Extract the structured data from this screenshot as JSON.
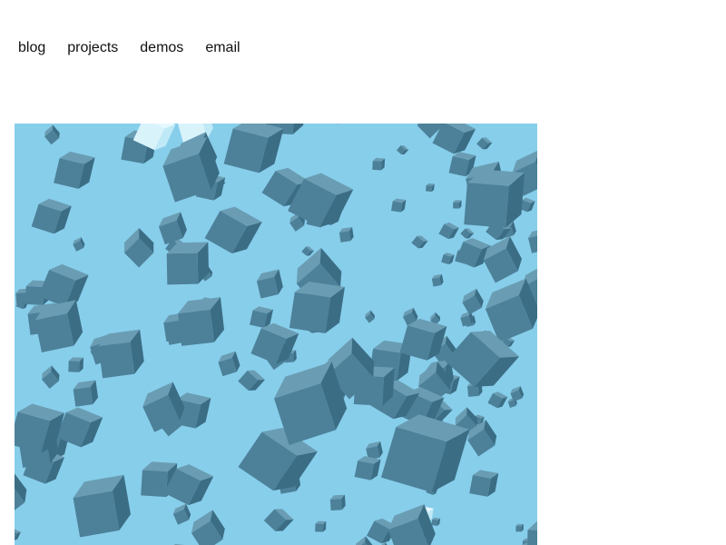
{
  "nav": {
    "items": [
      {
        "label": "blog"
      },
      {
        "label": "projects"
      },
      {
        "label": "demos"
      },
      {
        "label": "email"
      }
    ]
  },
  "scene": {
    "background_color": "#87ceeb",
    "cube_color": "#4d8199",
    "cube_top_color": "#6a9db3",
    "cube_side_color": "#3b6d85",
    "highlight_color": "#e6f8ff"
  }
}
